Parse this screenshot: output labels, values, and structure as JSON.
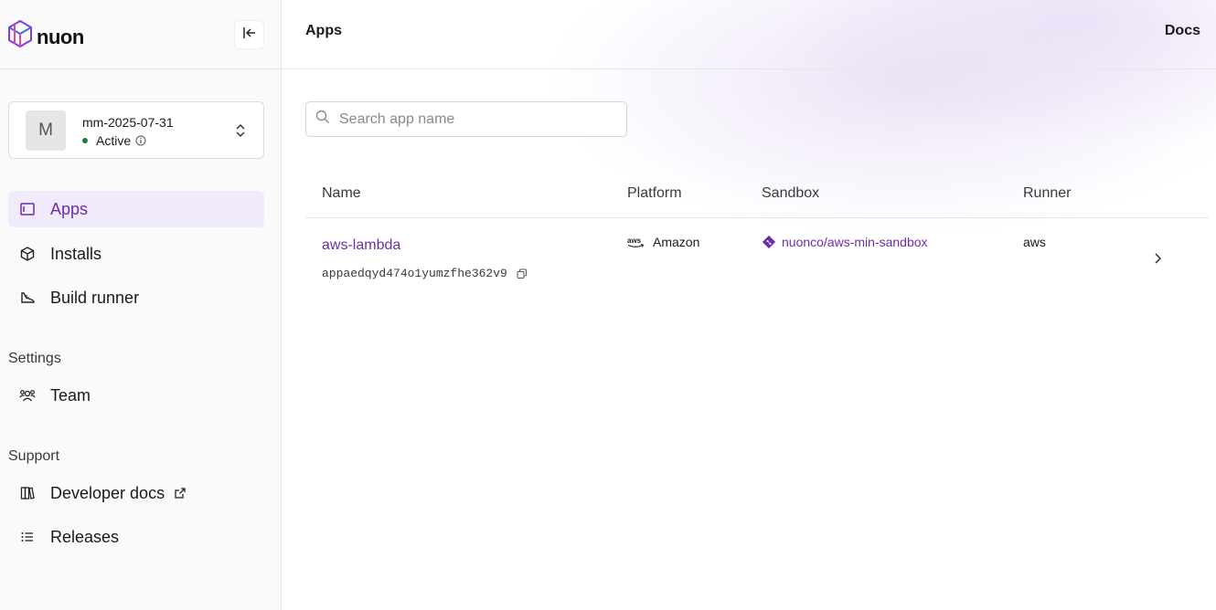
{
  "brand": {
    "name": "nuon"
  },
  "org": {
    "initial": "M",
    "name": "mm-2025-07-31",
    "status": "Active"
  },
  "nav": {
    "main": [
      {
        "label": "Apps",
        "icon": "apps-icon",
        "active": true
      },
      {
        "label": "Installs",
        "icon": "cube-icon",
        "active": false
      },
      {
        "label": "Build runner",
        "icon": "sneaker-icon",
        "active": false
      }
    ],
    "settings_label": "Settings",
    "settings": [
      {
        "label": "Team",
        "icon": "team-icon"
      }
    ],
    "support_label": "Support",
    "support": [
      {
        "label": "Developer docs",
        "icon": "books-icon",
        "external": true
      },
      {
        "label": "Releases",
        "icon": "list-icon"
      }
    ]
  },
  "header": {
    "title": "Apps",
    "docs_label": "Docs"
  },
  "search": {
    "placeholder": "Search app name",
    "value": ""
  },
  "table": {
    "columns": [
      "Name",
      "Platform",
      "Sandbox",
      "Runner"
    ],
    "rows": [
      {
        "name": "aws-lambda",
        "id": "appaedqyd474o1yumzfhe362v9",
        "platform": "Amazon",
        "sandbox": "nuonco/aws-min-sandbox",
        "runner": "aws"
      }
    ]
  },
  "colors": {
    "accent": "#6b2fa8",
    "active_bg": "#f1eafb",
    "status_green": "#1f7a3e"
  }
}
